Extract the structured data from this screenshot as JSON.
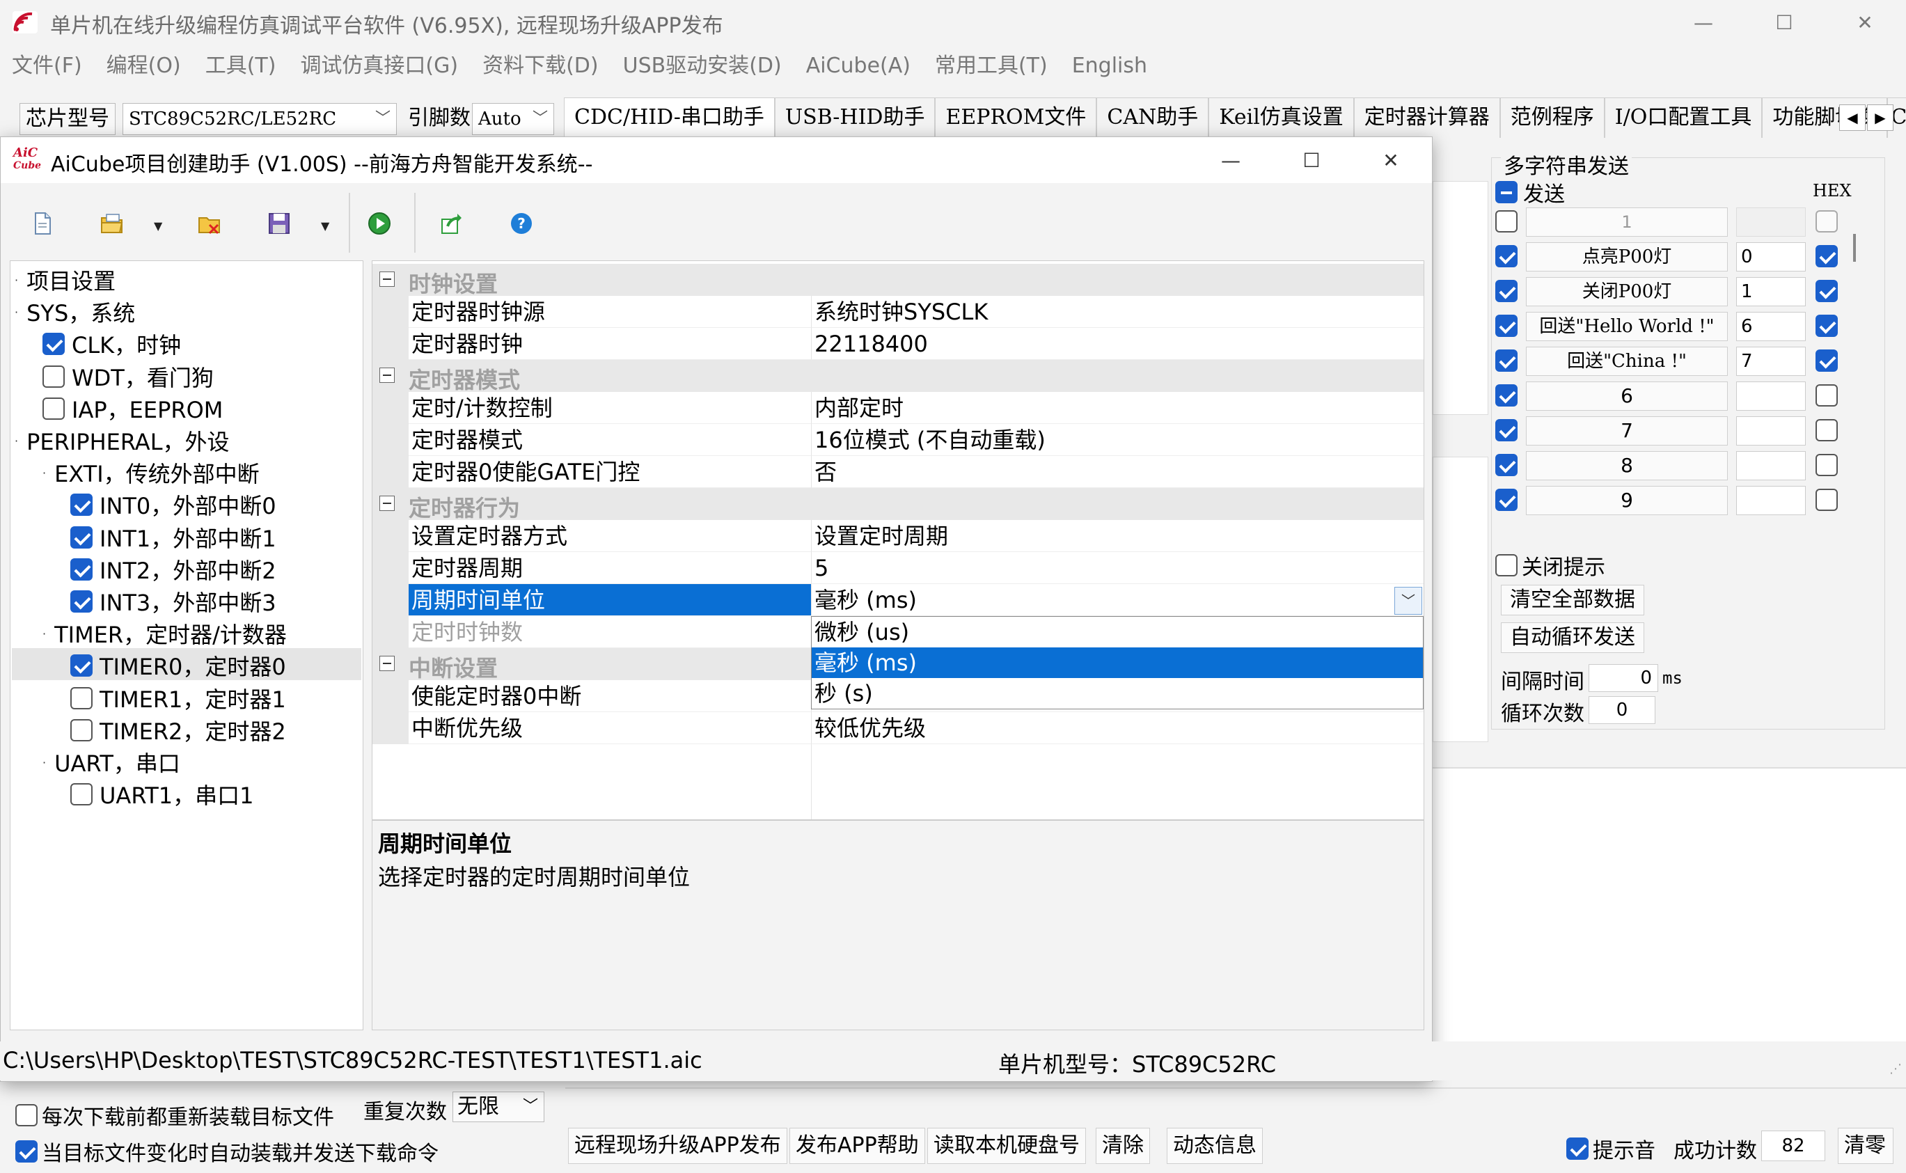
{
  "main": {
    "title": "单片机在线升级编程仿真调试平台软件 (V6.95X), 远程现场升级APP发布",
    "menu": [
      "文件(F)",
      "编程(O)",
      "工具(T)",
      "调试仿真接口(G)",
      "资料下载(D)",
      "USB驱动安装(D)",
      "AiCube(A)",
      "常用工具(T)",
      "English"
    ],
    "chip_label": "芯片型号",
    "chip_value": "STC89C52RC/LE52RC",
    "pin_label": "引脚数",
    "pin_value": "Auto",
    "tabs": [
      "CDC/HID-串口助手",
      "USB-HID助手",
      "EEPROM文件",
      "CAN助手",
      "Keil仿真设置",
      "定时器计算器",
      "范例程序",
      "I/O口配置工具",
      "功能脚切换",
      "CAN"
    ]
  },
  "multi_send": {
    "title": "多字符串发送",
    "send_label": "发送",
    "hex_label": "HEX",
    "rows": [
      {
        "checked": false,
        "label": "1",
        "value": "",
        "hex": false,
        "disabled": true
      },
      {
        "checked": true,
        "label": "点亮P00灯",
        "value": "0",
        "hex": true
      },
      {
        "checked": true,
        "label": "关闭P00灯",
        "value": "1",
        "hex": true
      },
      {
        "checked": true,
        "label": "回送\"Hello World !\"",
        "value": "6",
        "hex": true
      },
      {
        "checked": true,
        "label": "回送\"China !\"",
        "value": "7",
        "hex": true
      },
      {
        "checked": true,
        "label": "6",
        "value": "",
        "hex": false
      },
      {
        "checked": true,
        "label": "7",
        "value": "",
        "hex": false
      },
      {
        "checked": true,
        "label": "8",
        "value": "",
        "hex": false
      },
      {
        "checked": true,
        "label": "9",
        "value": "",
        "hex": false
      }
    ],
    "close_tip": "关闭提示",
    "clear_all": "清空全部数据",
    "auto_loop": "自动循环发送",
    "interval_label": "间隔时间",
    "interval_value": "0",
    "interval_unit": "ms",
    "loop_label": "循环次数",
    "loop_value": "0"
  },
  "bottom": {
    "reload_each": "每次下载前都重新装载目标文件",
    "auto_reload": "当目标文件变化时自动装载并发送下载命令",
    "retry_label": "重复次数",
    "retry_value": "无限",
    "buttons": [
      "远程现场升级APP发布",
      "发布APP帮助",
      "读取本机硬盘号",
      "清除",
      "动态信息"
    ],
    "tip_sound": "提示音",
    "success_label": "成功计数",
    "success_count": "82",
    "clear_count": "清零"
  },
  "dialog": {
    "title": "AiCube项目创建助手 (V1.00S) --前海方舟智能开发系统--",
    "tree": [
      {
        "label": "项目设置",
        "level": 0,
        "cb": "none"
      },
      {
        "label": "SYS，系统",
        "level": 0,
        "cb": "none"
      },
      {
        "label": "CLK，时钟",
        "level": 1,
        "cb": "on"
      },
      {
        "label": "WDT，看门狗",
        "level": 1,
        "cb": "off"
      },
      {
        "label": "IAP，EEPROM",
        "level": 1,
        "cb": "off"
      },
      {
        "label": "PERIPHERAL，外设",
        "level": 0,
        "cb": "none"
      },
      {
        "label": "EXTI，传统外部中断",
        "level": 1,
        "cb": "none"
      },
      {
        "label": "INT0，外部中断0",
        "level": 2,
        "cb": "on"
      },
      {
        "label": "INT1，外部中断1",
        "level": 2,
        "cb": "on"
      },
      {
        "label": "INT2，外部中断2",
        "level": 2,
        "cb": "on"
      },
      {
        "label": "INT3，外部中断3",
        "level": 2,
        "cb": "on"
      },
      {
        "label": "TIMER，定时器/计数器",
        "level": 1,
        "cb": "none"
      },
      {
        "label": "TIMER0，定时器0",
        "level": 2,
        "cb": "on"
      },
      {
        "label": "TIMER1，定时器1",
        "level": 2,
        "cb": "off"
      },
      {
        "label": "TIMER2，定时器2",
        "level": 2,
        "cb": "off"
      },
      {
        "label": "UART，串口",
        "level": 1,
        "cb": "none"
      },
      {
        "label": "UART1，串口1",
        "level": 2,
        "cb": "off"
      }
    ],
    "props": {
      "cat1": "时钟设置",
      "clk_src_k": "定时器时钟源",
      "clk_src_v": "系统时钟SYSCLK",
      "clk_k": "定时器时钟",
      "clk_v": "22118400",
      "cat2": "定时器模式",
      "ctl_k": "定时/计数控制",
      "ctl_v": "内部定时",
      "mode_k": "定时器模式",
      "mode_v": "16位模式 (不自动重载)",
      "gate_k": "定时器0使能GATE门控",
      "gate_v": "否",
      "cat3": "定时器行为",
      "way_k": "设置定时器方式",
      "way_v": "设置定时周期",
      "period_k": "定时器周期",
      "period_v": "5",
      "unit_k": "周期时间单位",
      "unit_v": "毫秒 (ms)",
      "ticks_k": "定时时钟数",
      "cat4": "中断设置",
      "int_en_k": "使能定时器0中断",
      "prio_k": "中断优先级",
      "prio_v": "较低优先级"
    },
    "dropdown": [
      "微秒 (us)",
      "毫秒 (ms)",
      "秒 (s)"
    ],
    "desc_title": "周期时间单位",
    "desc_text": "选择定时器的定时周期时间单位",
    "path": "C:\\Users\\HP\\Desktop\\TEST\\STC89C52RC-TEST\\TEST1\\TEST1.aic",
    "chip": "单片机型号：STC89C52RC"
  },
  "colors": {
    "accent": "#0a6fd4",
    "check": "#1a5fcc",
    "logo_red": "#c8102e"
  }
}
